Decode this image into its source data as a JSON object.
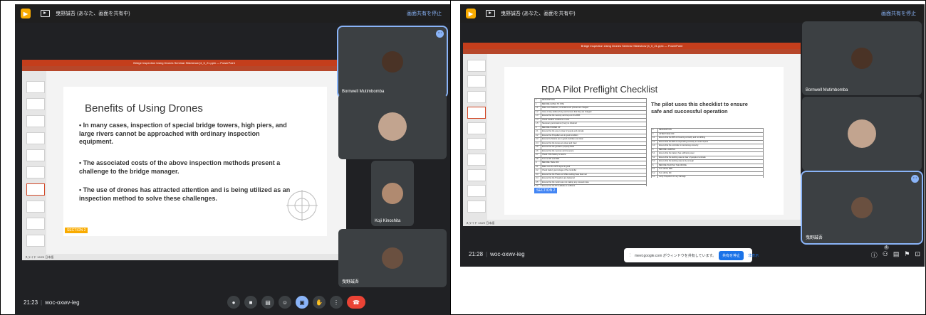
{
  "left": {
    "banner": {
      "message": "曳野誠吾 (あなた、画面を共有中)",
      "stop": "画面共有を停止"
    },
    "ppt": {
      "title": "Bridge Inspection Using Drones Seminar Slideshow [4_5_21.pptx — PowerPoint",
      "status": "スライド 12/29  日本語",
      "slide": {
        "title": "Benefits of Using Drones",
        "bullets": [
          "• In many cases, inspection of special bridge towers, high piers, and large rivers cannot be approached with ordinary inspection equipment.",
          "• The associated costs of the above inspection methods present a challenge to the bridge manager.",
          "• The use of drones has attracted attention and is being utilized as an inspection method to solve these challenges."
        ],
        "section": "SECTION 2"
      }
    },
    "participants": [
      {
        "name": "Bornwell Mutimbomba"
      },
      {
        "name": ""
      },
      {
        "name": "Koji Kinoshita"
      },
      {
        "name": "曳野誠吾"
      }
    ],
    "bottom": {
      "time": "21:23",
      "sep": "|",
      "code": "woc-oxwv-ieg"
    },
    "colors": {
      "accent": "#8ab4f8",
      "hangup": "#ea4335",
      "ppt": "#c43e1c"
    }
  },
  "right": {
    "banner": {
      "message": "曳野誠吾 (あなた、画面を共有中)",
      "stop": "画面共有を停止"
    },
    "ppt": {
      "title": "Bridge Inspection Using Drones Seminar Slideshow [4_5_21.pptx — PowerPoint",
      "status": "スライド 13/29  日本語",
      "slide": {
        "title": "RDA Pilot Preflight Checklist",
        "desc": "The pilot uses this checklist to ensure safe and successful operation",
        "section": "SECTION 2",
        "table1": [
          [
            "1",
            "DESCRIPTION"
          ],
          [
            "1",
            "BEFORE GOING TO SITE"
          ],
          [
            "1.1",
            "Make sure batteries, controllers and phones are charged"
          ],
          [
            "1.2",
            "Carry 2 way-radios (if any) and ensure that they are charged"
          ],
          [
            "1.3",
            "Ensure that the memory card is put in the RPA"
          ],
          [
            "1.4",
            "Check weather conditions on site"
          ],
          [
            "1.5",
            "Necessary permissions (if any) is obtained"
          ],
          [
            "2",
            "BEFORE POWER UP"
          ],
          [
            "2.1",
            "Ensure that the area is clear of people and animals"
          ],
          [
            "2.2",
            "Ensure that Propellers are in good condition"
          ],
          [
            "2.3",
            "Ensure the Motors are in good condition and clean"
          ],
          [
            "2.4",
            "Ensure that the lenses are clean and clear"
          ],
          [
            "2.5",
            "Ensure that the gimbal is properly fitted"
          ],
          [
            "2.6",
            "Ensure that the memory card is secure"
          ],
          [
            "2.7",
            "Check if the battery is secure"
          ],
          [
            "2.8",
            "Turn on RC and RPA"
          ],
          [
            "3",
            "BEFORE TAKE OFF"
          ],
          [
            "3.1",
            "Make sure the GPS signal is good"
          ],
          [
            "3.2",
            "Check battery percentage of the controller"
          ],
          [
            "3.3",
            "Ensure that the Photo and Video setting have been set"
          ],
          [
            "3.4",
            "Ensure that the Propellers are balanced"
          ],
          [
            "3.5",
            "Ensure that the motors are not making any unusual noise"
          ],
          [
            "3.6",
            "Ensure that the RTH altitude is sufficient"
          ],
          [
            "3.7",
            "Make sure to inspect all nuts, bolts and screws"
          ],
          [
            "3.8",
            "Ensure all required antennas are secured"
          ]
        ],
        "table2": [
          [
            "4",
            "DESCRIPTION"
          ],
          [
            "4",
            "AFTER TAKE OFF"
          ],
          [
            "4.1",
            "Ensure that the RPA is hovering correctly and not drifting"
          ],
          [
            "4.2",
            "Ensure that the RPA is responding correctly to control inputs"
          ],
          [
            "4.3",
            "Ensure that the controller is functioning correctly"
          ],
          [
            "5",
            "BEFORE LANDING"
          ],
          [
            "5.1",
            "Ensure that the battery has sufficient power"
          ],
          [
            "5.2",
            "Ensure that the landing area is clear of people or animals"
          ],
          [
            "5.3",
            "Ensure that the landing area is dry enough"
          ],
          [
            "6",
            "BEFORE PACKING THE DRONE"
          ],
          [
            "6.1",
            "Turn off the RPA"
          ],
          [
            "6.2",
            "Turn off the RC"
          ],
          [
            "6.3",
            "Verify Propellers for any damage"
          ],
          [
            "6.4",
            "Check if the gimbal and lens are in place and covered"
          ],
          [
            "6.5",
            "Check the battery use and condition"
          ]
        ]
      }
    },
    "participants": [
      {
        "name": "Bornwell Mutimbomba"
      },
      {
        "name": ""
      },
      {
        "name": "曳野誠吾"
      }
    ],
    "share": {
      "message": "meet.google.com がウィンドウを共有しています。",
      "stop": "共有を停止",
      "hide": "非表示"
    },
    "bottom": {
      "time": "21:28",
      "sep": "|",
      "code": "woc-oxwv-ieg",
      "count": "4"
    }
  }
}
